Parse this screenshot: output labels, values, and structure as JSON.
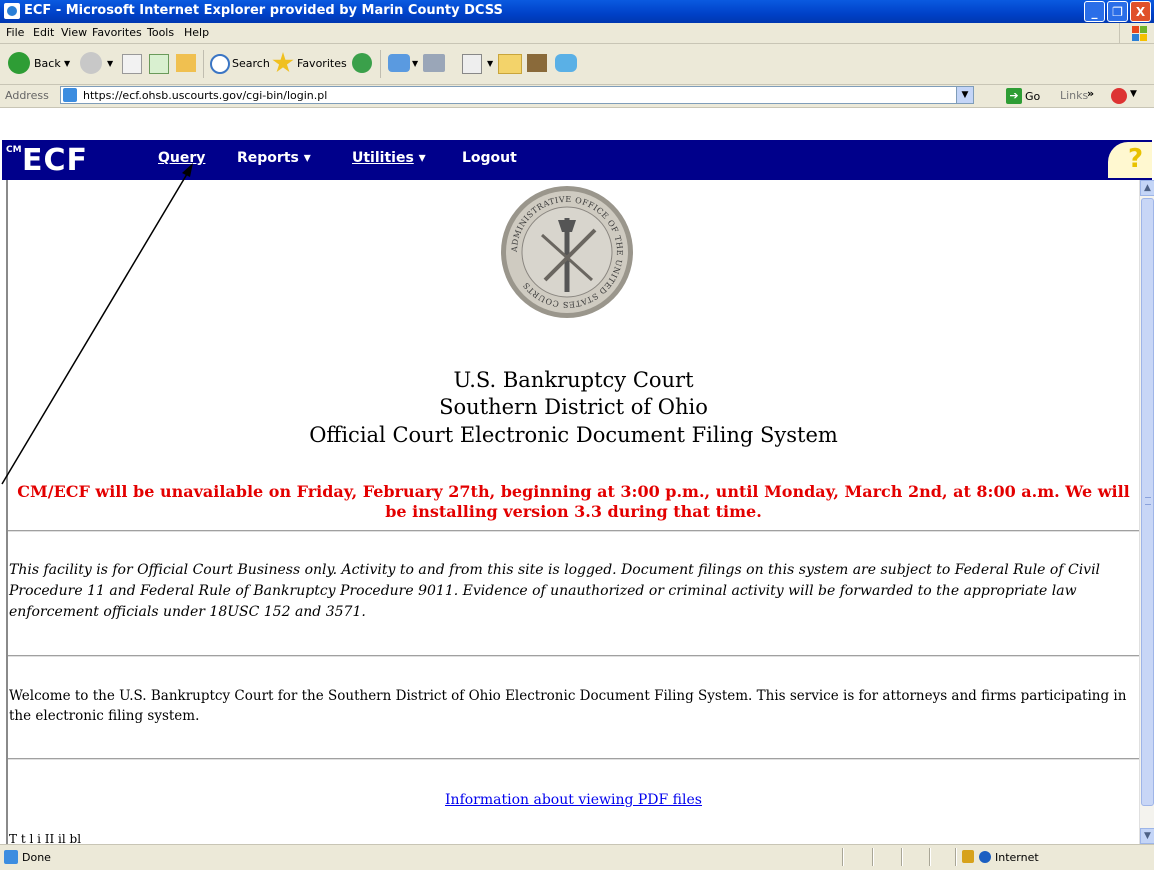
{
  "window": {
    "title": "ECF - Microsoft Internet Explorer provided by Marin County DCSS",
    "controls": {
      "minimize": "_",
      "maximize": "❐",
      "close": "X"
    }
  },
  "menu": [
    "File",
    "Edit",
    "View",
    "Favorites",
    "Tools",
    "Help"
  ],
  "toolbar": {
    "back": "Back",
    "search": "Search",
    "favorites": "Favorites"
  },
  "address": {
    "label": "Address",
    "url": "https://ecf.ohsb.uscourts.gov/cgi-bin/login.pl",
    "go": "Go",
    "links": "Links",
    "links_chevron": "»"
  },
  "ecf": {
    "logo_cm": "CM",
    "logo": "ECF",
    "nav": {
      "query": "Query",
      "reports": "Reports",
      "utilities": "Utilities",
      "logout": "Logout",
      "dropdown": "▾"
    },
    "help": "?"
  },
  "page": {
    "seal_text": "ADMINISTRATIVE OFFICE OF THE UNITED STATES COURTS",
    "title_lines": [
      "U.S. Bankruptcy Court",
      "Southern District of Ohio",
      "Official Court Electronic Document Filing System"
    ],
    "notice": "CM/ECF will be unavailable on Friday, February 27th, beginning at 3:00 p.m., until Monday, March 2nd, at 8:00 a.m. We will be installing version 3.3 during that time.",
    "disclaimer": "This facility is for Official Court Business only. Activity to and from this site is logged. Document filings on this system are subject to Federal Rule of Civil Procedure 11 and Federal Rule of Bankruptcy Procedure 9011. Evidence of unauthorized or criminal activity will be forwarded to the appropriate law enforcement officials under 18USC 152 and 3571.",
    "welcome": "Welcome to the U.S. Bankruptcy Court for the Southern District of Ohio Electronic Document Filing System. This service is for attorneys and firms participating in the electronic filing system.",
    "pdf_link": "Information about viewing PDF files",
    "cutoff_text": "T   t l   i  II   il bl"
  },
  "status": {
    "text": "Done",
    "zone": "Internet"
  },
  "colors": {
    "titlebar": "#0041c8",
    "ecf_nav": "#00008b",
    "notice": "#e30000",
    "link": "#0000ee"
  }
}
